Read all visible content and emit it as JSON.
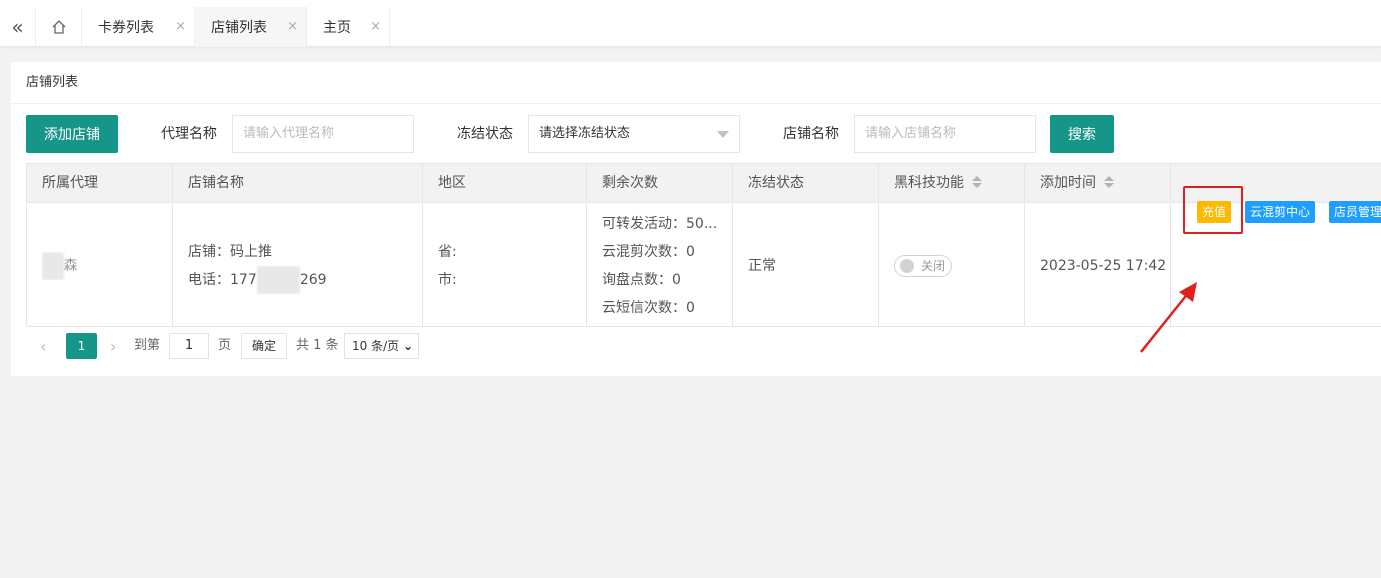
{
  "tabs": [
    {
      "label": "卡券列表"
    },
    {
      "label": "店铺列表"
    },
    {
      "label": "主页"
    }
  ],
  "tab_close": "×",
  "card_title": "店铺列表",
  "filters": {
    "add_button": "添加店铺",
    "agent_label": "代理名称",
    "agent_placeholder": "请输入代理名称",
    "freeze_label": "冻结状态",
    "freeze_value": "请选择冻结状态",
    "store_label": "店铺名称",
    "store_placeholder": "请输入店铺名称",
    "search_button": "搜索"
  },
  "table": {
    "headers": [
      "所属代理",
      "店铺名称",
      "地区",
      "剩余次数",
      "冻结状态",
      "黑科技功能",
      "添加时间"
    ],
    "row": {
      "agent_suffix": "森",
      "store_name": "店铺：码上推",
      "phone_prefix": "电话：177",
      "phone_suffix": "269",
      "province": "省:",
      "city": "市:",
      "counts": [
        "可转发活动：50...",
        "云混剪次数：0",
        "询盘点数：0",
        "云短信次数：0"
      ],
      "freeze_status": "正常",
      "switch_label": "关闭",
      "added_time": "2023-05-25 17:42",
      "ops": [
        "充值",
        "云混剪中心",
        "店员管理"
      ]
    }
  },
  "pager": {
    "current": "1",
    "goto_label": "到第",
    "page_input": "1",
    "page_unit": "页",
    "confirm": "确定",
    "total": "共 1 条",
    "page_size": "10 条/页"
  },
  "colors": {
    "primary": "#169688",
    "warning": "#ffb800",
    "info": "#1e9fff",
    "highlight": "#e02020"
  }
}
